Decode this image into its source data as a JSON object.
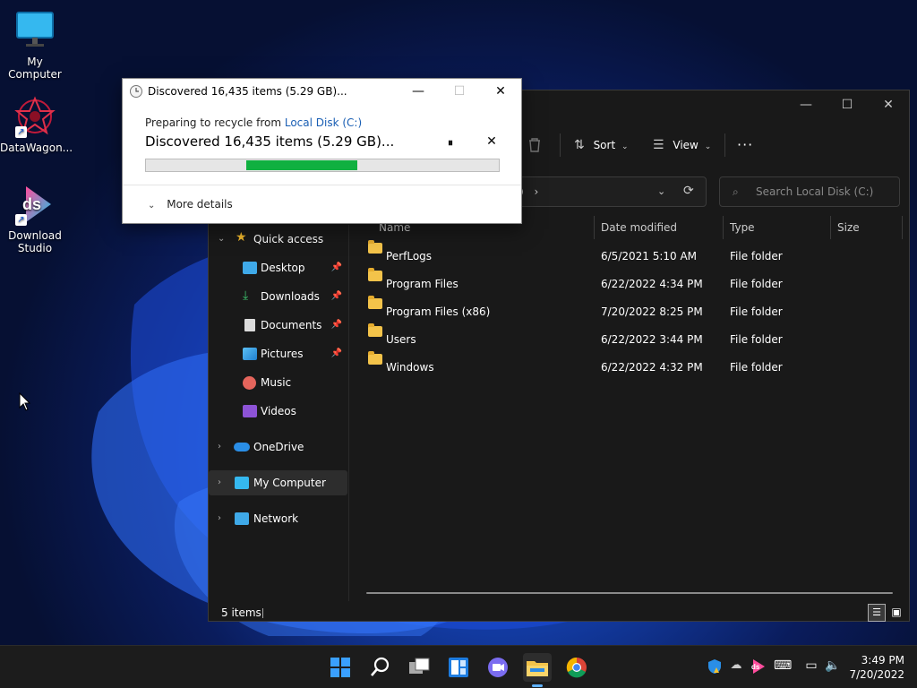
{
  "desktop": {
    "icons": [
      {
        "label": "My Computer"
      },
      {
        "label": "DataWagon..."
      },
      {
        "label": "Download Studio"
      }
    ]
  },
  "dialog": {
    "title": "Discovered 16,435 items (5.29 GB)...",
    "preparing_prefix": "Preparing to recycle from ",
    "preparing_link": "Local Disk (C:)",
    "discovered": "Discovered 16,435 items (5.29 GB)...",
    "pause_label": "⏸",
    "more_details": "More details",
    "progress": {
      "start": 0.285,
      "end": 0.6
    }
  },
  "explorer": {
    "toolbar": {
      "sort": "Sort",
      "view": "View",
      "more": "···"
    },
    "address_fragment": ")",
    "search_placeholder": "Search Local Disk (C:)",
    "columns": {
      "name": "Name",
      "date": "Date modified",
      "type": "Type",
      "size": "Size"
    },
    "nav": {
      "quick_access": "Quick access",
      "items": [
        {
          "label": "Desktop",
          "pinned": true
        },
        {
          "label": "Downloads",
          "pinned": true
        },
        {
          "label": "Documents",
          "pinned": true
        },
        {
          "label": "Pictures",
          "pinned": true
        },
        {
          "label": "Music",
          "pinned": false
        },
        {
          "label": "Videos",
          "pinned": false
        }
      ],
      "onedrive": "OneDrive",
      "my_computer": "My Computer",
      "network": "Network"
    },
    "rows": [
      {
        "name": "PerfLogs",
        "date": "6/5/2021 5:10 AM",
        "type": "File folder"
      },
      {
        "name": "Program Files",
        "date": "6/22/2022 4:34 PM",
        "type": "File folder"
      },
      {
        "name": "Program Files (x86)",
        "date": "7/20/2022 8:25 PM",
        "type": "File folder"
      },
      {
        "name": "Users",
        "date": "6/22/2022 3:44 PM",
        "type": "File folder"
      },
      {
        "name": "Windows",
        "date": "6/22/2022 4:32 PM",
        "type": "File folder"
      }
    ],
    "status": "5 items"
  },
  "taskbar": {
    "time": "3:49 PM",
    "date": "7/20/2022"
  }
}
